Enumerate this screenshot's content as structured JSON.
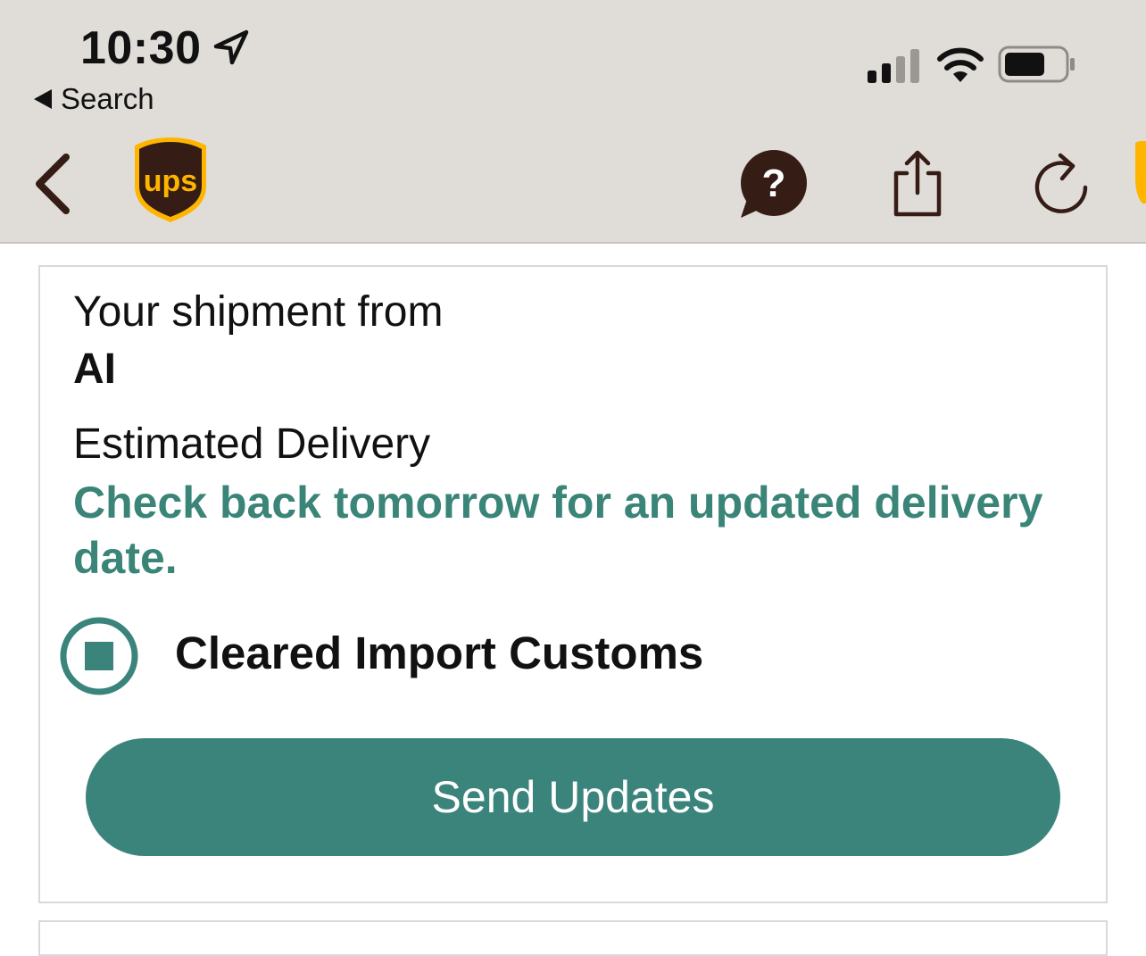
{
  "status_bar": {
    "time": "10:30",
    "back_app_label": "Search",
    "icons": [
      "location-arrow-icon",
      "cellular-signal-icon",
      "wifi-icon",
      "battery-icon"
    ]
  },
  "nav_bar": {
    "icons": [
      "chevron-left-icon",
      "ups-logo",
      "help-chat-icon",
      "share-icon",
      "refresh-icon"
    ],
    "logo_text": "ups"
  },
  "shipment": {
    "from_label": "Your shipment from",
    "from_value": "AI",
    "estimated_label": "Estimated Delivery",
    "estimated_value": "Check back tomorrow for an updated delivery date.",
    "status": "Cleared Import Customs",
    "send_updates_label": "Send Updates"
  },
  "colors": {
    "accent": "#3b847c",
    "brand_brown": "#351c15",
    "brand_gold": "#ffb500",
    "header_bg": "#e0ddd9"
  }
}
